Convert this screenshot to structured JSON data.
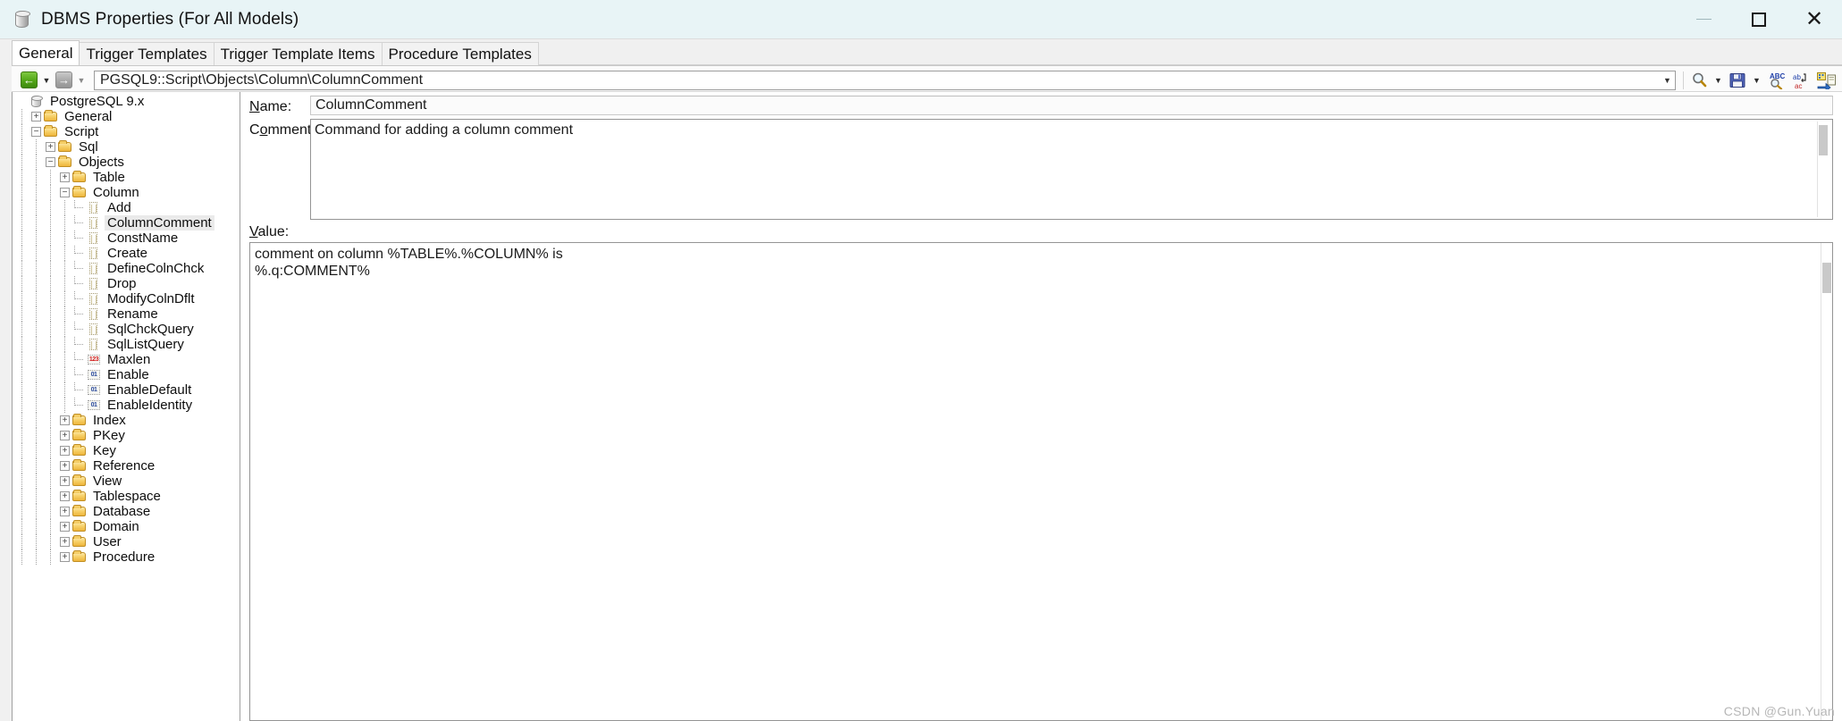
{
  "window": {
    "title": "DBMS Properties (For All Models)",
    "icon": "database-cylinder-icon",
    "minimize_label": "Minimize",
    "maximize_label": "Maximize",
    "close_label": "Close"
  },
  "tabs": [
    {
      "label": "General",
      "active": true
    },
    {
      "label": "Trigger Templates",
      "active": false
    },
    {
      "label": "Trigger Template Items",
      "active": false
    },
    {
      "label": "Procedure Templates",
      "active": false
    }
  ],
  "toolbar": {
    "back_label": "Back",
    "back_caret": "▼",
    "forward_label": "Forward",
    "forward_caret": "▼",
    "path_value": "PGSQL9::Script\\Objects\\Column\\ColumnComment",
    "path_caret": "▼",
    "buttons": [
      {
        "name": "find-icon",
        "label": "Find"
      },
      {
        "name": "find-dropdown-caret",
        "label": "▼"
      },
      {
        "name": "save-icon",
        "label": "Save"
      },
      {
        "name": "save-dropdown-caret",
        "label": "▼"
      },
      {
        "name": "spell-check-icon",
        "label": "Spell Check"
      },
      {
        "name": "replace-icon",
        "label": "Replace"
      },
      {
        "name": "insert-object-icon",
        "label": "Insert Object"
      }
    ]
  },
  "tree": {
    "nodes": [
      {
        "label": "PostgreSQL 9.x",
        "depth": 0,
        "icon": "database",
        "state": "none",
        "selected": false
      },
      {
        "label": "General",
        "depth": 1,
        "icon": "folder",
        "state": "collapsed",
        "selected": false
      },
      {
        "label": "Script",
        "depth": 1,
        "icon": "folder",
        "state": "expanded",
        "selected": false
      },
      {
        "label": "Sql",
        "depth": 2,
        "icon": "folder",
        "state": "collapsed",
        "selected": false
      },
      {
        "label": "Objects",
        "depth": 2,
        "icon": "folder",
        "state": "expanded",
        "selected": false
      },
      {
        "label": "Table",
        "depth": 3,
        "icon": "folder",
        "state": "collapsed",
        "selected": false
      },
      {
        "label": "Column",
        "depth": 3,
        "icon": "folder",
        "state": "expanded",
        "selected": false
      },
      {
        "label": "Add",
        "depth": 4,
        "icon": "doc",
        "state": "leaf",
        "selected": false
      },
      {
        "label": "ColumnComment",
        "depth": 4,
        "icon": "doc",
        "state": "leaf",
        "selected": true
      },
      {
        "label": "ConstName",
        "depth": 4,
        "icon": "doc",
        "state": "leaf",
        "selected": false
      },
      {
        "label": "Create",
        "depth": 4,
        "icon": "doc",
        "state": "leaf",
        "selected": false
      },
      {
        "label": "DefineColnChck",
        "depth": 4,
        "icon": "doc",
        "state": "leaf",
        "selected": false
      },
      {
        "label": "Drop",
        "depth": 4,
        "icon": "doc",
        "state": "leaf",
        "selected": false
      },
      {
        "label": "ModifyColnDflt",
        "depth": 4,
        "icon": "doc",
        "state": "leaf",
        "selected": false
      },
      {
        "label": "Rename",
        "depth": 4,
        "icon": "doc",
        "state": "leaf",
        "selected": false
      },
      {
        "label": "SqlChckQuery",
        "depth": 4,
        "icon": "doc",
        "state": "leaf",
        "selected": false
      },
      {
        "label": "SqlListQuery",
        "depth": 4,
        "icon": "doc",
        "state": "leaf",
        "selected": false
      },
      {
        "label": "Maxlen",
        "depth": 4,
        "icon": "number",
        "state": "leaf",
        "selected": false
      },
      {
        "label": "Enable",
        "depth": 4,
        "icon": "bool",
        "state": "leaf",
        "selected": false
      },
      {
        "label": "EnableDefault",
        "depth": 4,
        "icon": "bool",
        "state": "leaf",
        "selected": false
      },
      {
        "label": "EnableIdentity",
        "depth": 4,
        "icon": "bool",
        "state": "leaf",
        "selected": false
      },
      {
        "label": "Index",
        "depth": 3,
        "icon": "folder",
        "state": "collapsed",
        "selected": false
      },
      {
        "label": "PKey",
        "depth": 3,
        "icon": "folder",
        "state": "collapsed",
        "selected": false
      },
      {
        "label": "Key",
        "depth": 3,
        "icon": "folder",
        "state": "collapsed",
        "selected": false
      },
      {
        "label": "Reference",
        "depth": 3,
        "icon": "folder",
        "state": "collapsed",
        "selected": false
      },
      {
        "label": "View",
        "depth": 3,
        "icon": "folder",
        "state": "collapsed",
        "selected": false
      },
      {
        "label": "Tablespace",
        "depth": 3,
        "icon": "folder",
        "state": "collapsed",
        "selected": false
      },
      {
        "label": "Database",
        "depth": 3,
        "icon": "folder",
        "state": "collapsed",
        "selected": false
      },
      {
        "label": "Domain",
        "depth": 3,
        "icon": "folder",
        "state": "collapsed",
        "selected": false
      },
      {
        "label": "User",
        "depth": 3,
        "icon": "folder",
        "state": "collapsed",
        "selected": false
      },
      {
        "label": "Procedure",
        "depth": 3,
        "icon": "folder",
        "state": "collapsed",
        "selected": false
      }
    ],
    "glyph_expanded": "−",
    "glyph_collapsed": "+"
  },
  "detail": {
    "name_label_pre": "",
    "name_label_accel": "N",
    "name_label_post": "ame:",
    "name_value": "ColumnComment",
    "comment_label_pre": "C",
    "comment_label_accel": "o",
    "comment_label_post": "mment:",
    "comment_value": "Command for adding a column comment",
    "value_label_pre": "",
    "value_label_accel": "V",
    "value_label_post": "alue:",
    "value_text": "comment on column %TABLE%.%COLUMN% is\n%.q:COMMENT%"
  },
  "watermark": "CSDN @Gun.Yuan",
  "colors": {
    "titlebar_bg": "#e8f4f6",
    "accent_green": "#51a516",
    "folder": "#f2c64d",
    "selection": "#eaeaea"
  }
}
